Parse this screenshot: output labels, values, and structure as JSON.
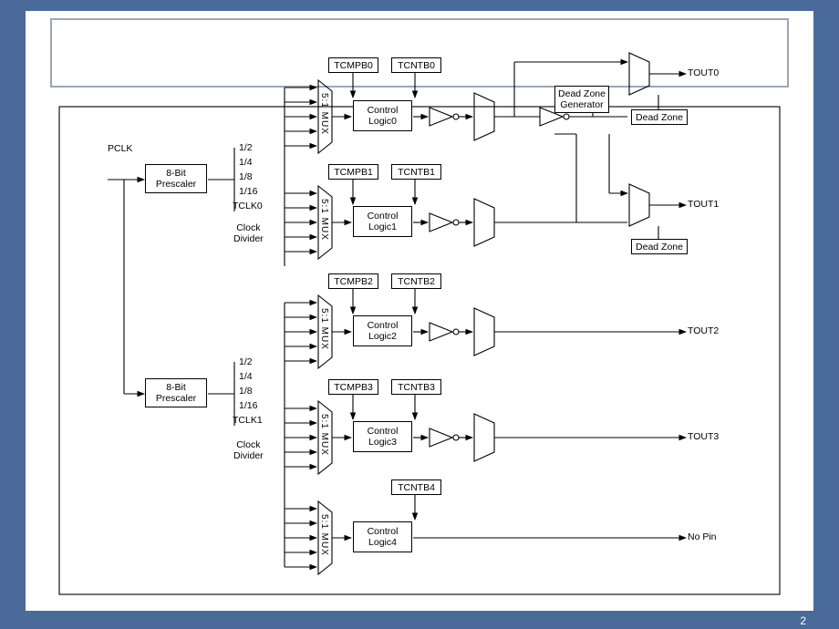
{
  "page_number": "2",
  "input_signal": "PCLK",
  "prescalers": [
    {
      "label": "8-Bit\nPrescaler"
    },
    {
      "label": "8-Bit\nPrescaler"
    }
  ],
  "clock_divider_label": "Clock\nDivider",
  "divider_ratios_a": [
    "1/2",
    "1/4",
    "1/8",
    "1/16",
    "TCLK0"
  ],
  "divider_ratios_b": [
    "1/2",
    "1/4",
    "1/8",
    "1/16",
    "TCLK1"
  ],
  "mux_label": "5:1 MUX",
  "channels": [
    {
      "cmp": "TCMPB0",
      "cnt": "TCNTB0",
      "logic": "Control\nLogic0",
      "out": "TOUT0",
      "has_cmp": true,
      "out_is_pin": true
    },
    {
      "cmp": "TCMPB1",
      "cnt": "TCNTB1",
      "logic": "Control\nLogic1",
      "out": "TOUT1",
      "has_cmp": true,
      "out_is_pin": true
    },
    {
      "cmp": "TCMPB2",
      "cnt": "TCNTB2",
      "logic": "Control\nLogic2",
      "out": "TOUT2",
      "has_cmp": true,
      "out_is_pin": true
    },
    {
      "cmp": "TCMPB3",
      "cnt": "TCNTB3",
      "logic": "Control\nLogic3",
      "out": "TOUT3",
      "has_cmp": true,
      "out_is_pin": true
    },
    {
      "cmp": "",
      "cnt": "TCNTB4",
      "logic": "Control\nLogic4",
      "out": "No Pin",
      "has_cmp": false,
      "out_is_pin": false
    }
  ],
  "dead_zone_gen": "Dead Zone\nGenerator",
  "dead_zone_label": "Dead Zone"
}
